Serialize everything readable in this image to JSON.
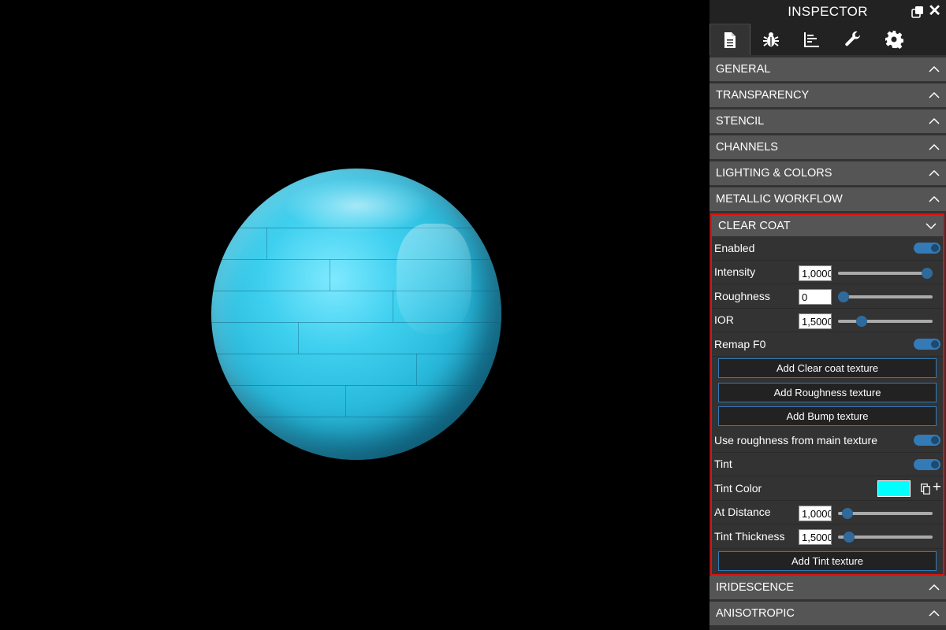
{
  "inspector": {
    "title": "INSPECTOR",
    "tabs": [
      {
        "icon": "document-icon"
      },
      {
        "icon": "bug-icon"
      },
      {
        "icon": "chart-icon"
      },
      {
        "icon": "wrench-icon"
      },
      {
        "icon": "gear-icon"
      }
    ],
    "sections_before": [
      {
        "label": "GENERAL"
      },
      {
        "label": "TRANSPARENCY"
      },
      {
        "label": "STENCIL"
      },
      {
        "label": "CHANNELS"
      },
      {
        "label": "LIGHTING & COLORS"
      },
      {
        "label": "METALLIC WORKFLOW"
      }
    ],
    "clear_coat": {
      "label": "CLEAR COAT",
      "enabled_label": "Enabled",
      "intensity_label": "Intensity",
      "intensity_value": "1,0000",
      "intensity_fraction": 1.0,
      "roughness_label": "Roughness",
      "roughness_value": "0",
      "roughness_fraction": 0.0,
      "ior_label": "IOR",
      "ior_value": "1,5000",
      "ior_fraction": 0.22,
      "remap_label": "Remap F0",
      "btn_clearcoat_texture": "Add Clear coat texture",
      "btn_roughness_texture": "Add Roughness texture",
      "btn_bump_texture": "Add Bump texture",
      "use_roughness_label": "Use roughness from main texture",
      "tint_label": "Tint",
      "tint_color_label": "Tint Color",
      "tint_color": "#00ffff",
      "at_distance_label": "At Distance",
      "at_distance_value": "1,0000",
      "at_distance_fraction": 0.05,
      "tint_thickness_label": "Tint Thickness",
      "tint_thickness_value": "1,5000",
      "tint_thickness_fraction": 0.07,
      "btn_tint_texture": "Add Tint texture"
    },
    "sections_after": [
      {
        "label": "IRIDESCENCE"
      },
      {
        "label": "ANISOTROPIC"
      }
    ]
  },
  "colors": {
    "accent": "#337ab7",
    "highlight_border": "#e01010",
    "section_header": "#555555",
    "panel": "#333333"
  }
}
